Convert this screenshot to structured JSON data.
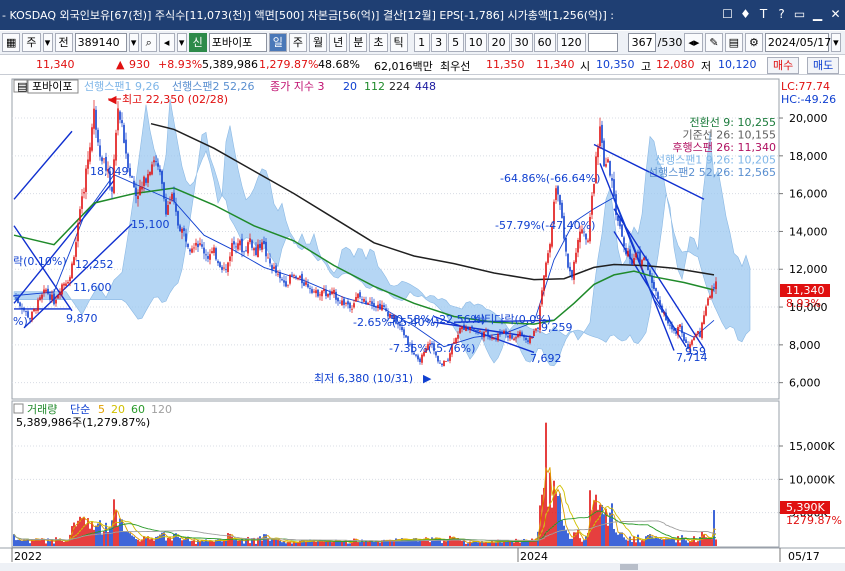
{
  "window": {
    "title": "- KOSDAQ 외국인보유[67(천)] 주식수[11,073(천)] 액면[500] 자본금[56(억)] 결산[12월] EPS[-1,786] 시가총액[1,256(억)] :"
  },
  "toolbar": {
    "type_select": "주",
    "prev_label": "전",
    "code": "389140",
    "badge": "신",
    "name": "포바이포",
    "period_day": "일",
    "period_week": "주",
    "period_month": "월",
    "period_year": "년",
    "period_minute": "분",
    "period_second": "초",
    "period_tick": "틱",
    "intervals": [
      "1",
      "3",
      "5",
      "10",
      "20",
      "30",
      "60",
      "120"
    ],
    "page_counter": "367",
    "page_total": "/530",
    "date": "2024/05/17"
  },
  "quote": {
    "price": "11,340",
    "change": "930",
    "change_pct": "+8.93%",
    "volume": "5,389,986",
    "vol_pct": "1,279.87%",
    "turnover_pct": "48.68%",
    "amount": "62,016백만",
    "best_bid_label": "최우선",
    "best_ask": "11,350",
    "best_bid": "11,340",
    "open_label": "시",
    "open": "10,350",
    "high_label": "고",
    "high": "12,080",
    "low_label": "저",
    "low": "10,120",
    "buy_button": "매수",
    "sell_button": "매도"
  },
  "chart_data": {
    "type": "candlestick",
    "price_panel": {
      "title": "포바이포",
      "ichimoku_labels": [
        "선행스팬1 9,26",
        "선행스팬2 52,26"
      ],
      "ma_legend_label": "종가 지수 3",
      "ma_periods": [
        "20",
        "112",
        "224",
        "448"
      ],
      "lc_label": "LC:77.74",
      "hc_label": "HC:-49.26",
      "y_ticks": [
        "20,000",
        "18,000",
        "16,000",
        "14,000",
        "12,000",
        "10,000",
        "8,000",
        "6,000"
      ],
      "ylim": [
        5400,
        21800
      ],
      "current_price_tag": "11,340",
      "current_pct_tag": "8.93%",
      "right_legend": [
        {
          "text": "전환선 9: 10,255",
          "color": "#1a7a3a"
        },
        {
          "text": "기준선 26: 10,155",
          "color": "#606060"
        },
        {
          "text": "후행스팬 26: 11,340",
          "color": "#b01060"
        },
        {
          "text": "선행스팬1 9,26: 10,205",
          "color": "#7fb6e8"
        },
        {
          "text": "선행스팬2 52,26: 12,565",
          "color": "#5a8fd0"
        }
      ],
      "annotations": {
        "high": "최고 22,350 (02/28)",
        "low": "최저 6,380 (10/31)",
        "p15100": "15,100",
        "p18049": "18,049",
        "p11600": "11,600",
        "p12252": "12,252",
        "p9870": "9,870",
        "p9259": "9,259",
        "p7692": "7,692",
        "p7714": "7,714",
        "pct1": "-64.86%(-66.64%)",
        "pct2": "-57.79%(-47.40%)",
        "pct3": "-30.58%(-22.56%)",
        "pct4": "-2.65%(-5.40%)",
        "pct5": "-7.35%(-5.76%)",
        "pct6": "버티다락(0.0%)",
        "pct7": "락(0.10%)",
        "pct8": "%)",
        "p959": "959"
      },
      "moving_averages": [
        {
          "name": "20",
          "color": "#1040d0",
          "points": [
            [
              0,
              10600
            ],
            [
              40,
              10800
            ],
            [
              70,
              14800
            ],
            [
              100,
              17000
            ],
            [
              130,
              16300
            ],
            [
              160,
              15600
            ],
            [
              190,
              13800
            ],
            [
              220,
              13000
            ],
            [
              250,
              12100
            ],
            [
              290,
              11400
            ],
            [
              330,
              10500
            ],
            [
              370,
              9900
            ],
            [
              400,
              9000
            ],
            [
              430,
              7900
            ],
            [
              460,
              8400
            ],
            [
              490,
              8600
            ],
            [
              520,
              9200
            ],
            [
              540,
              12500
            ],
            [
              560,
              14500
            ],
            [
              580,
              15200
            ],
            [
              600,
              15800
            ],
            [
              620,
              13200
            ],
            [
              640,
              10400
            ],
            [
              660,
              8900
            ],
            [
              680,
              8400
            ],
            [
              700,
              9300
            ]
          ]
        },
        {
          "name": "112",
          "color": "#1f8a2a",
          "points": [
            [
              0,
              13800
            ],
            [
              40,
              13300
            ],
            [
              80,
              15500
            ],
            [
              120,
              16000
            ],
            [
              160,
              16300
            ],
            [
              200,
              15400
            ],
            [
              240,
              14300
            ],
            [
              280,
              13500
            ],
            [
              320,
              12200
            ],
            [
              360,
              11100
            ],
            [
              400,
              10200
            ],
            [
              440,
              9500
            ],
            [
              480,
              9200
            ],
            [
              520,
              9100
            ],
            [
              540,
              9300
            ],
            [
              560,
              10200
            ],
            [
              580,
              11200
            ],
            [
              600,
              11700
            ],
            [
              620,
              11900
            ],
            [
              640,
              11600
            ],
            [
              670,
              11300
            ],
            [
              700,
              10900
            ]
          ]
        },
        {
          "name": "224",
          "color": "#202020",
          "points": [
            [
              137,
              19700
            ],
            [
              160,
              19400
            ],
            [
              200,
              18400
            ],
            [
              240,
              17200
            ],
            [
              280,
              16000
            ],
            [
              320,
              14700
            ],
            [
              360,
              13400
            ],
            [
              400,
              12700
            ],
            [
              440,
              12300
            ],
            [
              480,
              11800
            ],
            [
              520,
              11450
            ],
            [
              550,
              11500
            ],
            [
              580,
              12100
            ],
            [
              600,
              12250
            ],
            [
              630,
              12200
            ],
            [
              660,
              12050
            ],
            [
              700,
              11700
            ]
          ]
        }
      ],
      "candles": "generated from embedded OHLC series spanning 2022-01 to 2024-05-17"
    },
    "volume_panel": {
      "title": "거래량",
      "ma_label": "단순",
      "ma_periods": [
        {
          "p": "5",
          "color": "#e0a000"
        },
        {
          "p": "20",
          "color": "#d0c000"
        },
        {
          "p": "60",
          "color": "#2a9a2a"
        },
        {
          "p": "120",
          "color": "#a0a0a0"
        }
      ],
      "value_label": "5,389,986주(1,279.87%)",
      "y_ticks": [
        "15,000K",
        "10,000K",
        "5,000K"
      ],
      "ylim": [
        0,
        19500
      ],
      "current_tag": "5,390K",
      "current_pct_tag": "1279.87%"
    },
    "x_axis": {
      "labels": [
        "2022",
        "2024",
        "05/17"
      ]
    }
  }
}
